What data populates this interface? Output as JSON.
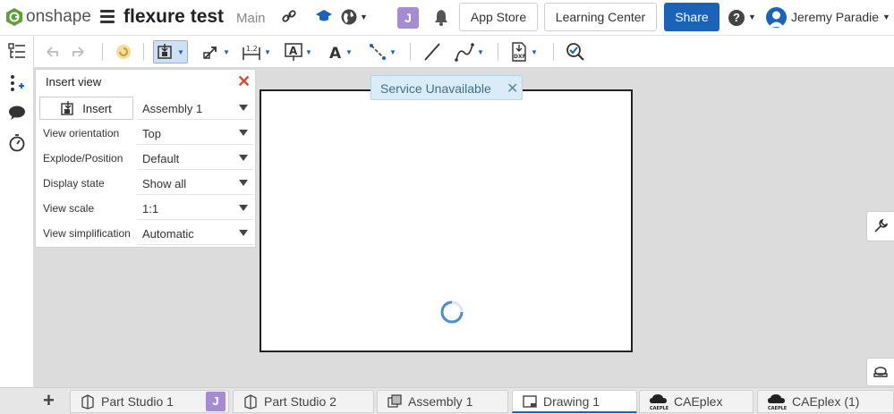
{
  "header": {
    "brand": "onshape",
    "doc_title": "flexure test",
    "branch": "Main",
    "user_badge": "J",
    "app_store": "App Store",
    "learning_center": "Learning Center",
    "share": "Share",
    "help": "?",
    "user_name": "Jeremy Paradie",
    "accent": "#1a63b8"
  },
  "panel": {
    "title": "Insert view",
    "insert_label": "Insert",
    "rows": [
      {
        "label": "",
        "value": "Assembly 1"
      },
      {
        "label": "View orientation",
        "value": "Top"
      },
      {
        "label": "Explode/Position",
        "value": "Default"
      },
      {
        "label": "Display state",
        "value": "Show all"
      },
      {
        "label": "View scale",
        "value": "1:1"
      },
      {
        "label": "View simplification",
        "value": "Automatic"
      }
    ]
  },
  "banner": {
    "text": "Service Unavailable"
  },
  "tabs": [
    {
      "label": "Part Studio 1",
      "icon": "part-studio-icon"
    },
    {
      "label": "Part Studio 2",
      "icon": "part-studio-icon"
    },
    {
      "label": "Assembly 1",
      "icon": "assembly-icon"
    },
    {
      "label": "Drawing 1",
      "icon": "drawing-icon"
    },
    {
      "label": "CAEplex",
      "icon": "caeplex-icon"
    },
    {
      "label": "CAEplex (1)",
      "icon": "caeplex-icon"
    }
  ],
  "tab_user_badge": "J",
  "add_tab": "+"
}
